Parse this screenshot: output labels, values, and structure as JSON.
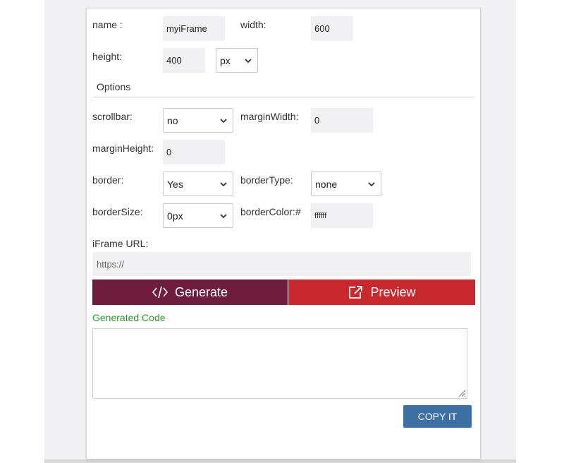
{
  "form": {
    "name_label": "name :",
    "name_value": "myiFrame",
    "width_label": "width:",
    "width_value": "600",
    "height_label": "height:",
    "height_value": "400",
    "unit_value": "px",
    "options_title": "Options",
    "scrollbar_label": "scrollbar:",
    "scrollbar_value": "no",
    "marginwidth_label": "marginWidth:",
    "marginwidth_value": "0",
    "marginheight_label": "marginHeight:",
    "marginheight_value": "0",
    "border_label": "border:",
    "border_value": "Yes",
    "bordertype_label": "borderType:",
    "bordertype_value": "none",
    "bordersize_label": "borderSize:",
    "bordersize_value": "0px",
    "bordercolor_label": "borderColor:#",
    "bordercolor_value": "ffffff",
    "url_label": "iFrame URL:",
    "url_placeholder": "https://"
  },
  "actions": {
    "generate_label": "Generate",
    "preview_label": "Preview",
    "generated_code_label": "Generated Code",
    "copy_label": "COPY IT"
  },
  "icons": {
    "generate": "code-icon",
    "preview": "external-link-icon",
    "select": "chevron-down-icon"
  },
  "colors": {
    "generate_button": "#6e1e3c",
    "preview_button": "#c8292f",
    "copy_button": "#3d6fa3",
    "generated_label": "#2a9a2a"
  }
}
